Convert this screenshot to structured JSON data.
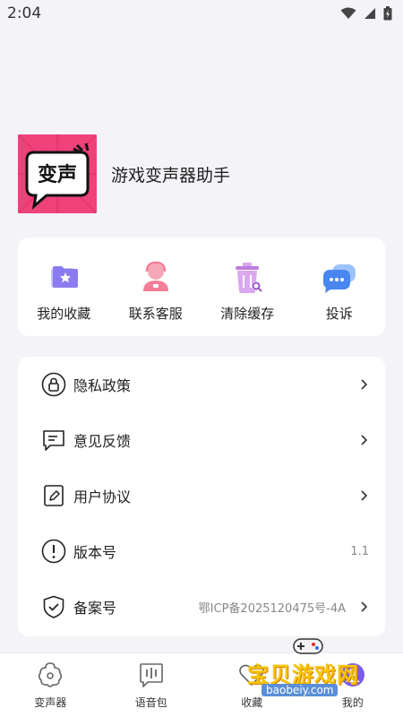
{
  "status_bar": {
    "time": "2:04"
  },
  "profile": {
    "app_name": "游戏变声器助手",
    "logo_text": "变声"
  },
  "quick_actions": [
    {
      "label": "我的收藏",
      "icon": "favorites-folder-icon"
    },
    {
      "label": "联系客服",
      "icon": "customer-service-icon"
    },
    {
      "label": "清除缓存",
      "icon": "clear-cache-icon"
    },
    {
      "label": "投诉",
      "icon": "complaint-chat-icon"
    }
  ],
  "menu": [
    {
      "label": "隐私政策",
      "value": "",
      "icon": "lock-icon"
    },
    {
      "label": "意见反馈",
      "value": "",
      "icon": "feedback-icon"
    },
    {
      "label": "用户协议",
      "value": "",
      "icon": "agreement-icon"
    },
    {
      "label": "版本号",
      "value": "1.1",
      "icon": "info-icon"
    },
    {
      "label": "备案号",
      "value": "鄂ICP备2025120475号-4A",
      "icon": "shield-check-icon"
    }
  ],
  "tabs": [
    {
      "label": "变声器",
      "icon": "voice-changer-icon"
    },
    {
      "label": "语音包",
      "icon": "voice-pack-icon"
    },
    {
      "label": "收藏",
      "icon": "heart-icon"
    },
    {
      "label": "我的",
      "icon": "profile-icon"
    }
  ],
  "watermark": {
    "title": "宝贝游戏网",
    "subtitle": "baobeiy.com"
  },
  "colors": {
    "background": "#f3f3f8",
    "logo_pink": "#f0427a",
    "accent_blue": "#4a86f0"
  }
}
